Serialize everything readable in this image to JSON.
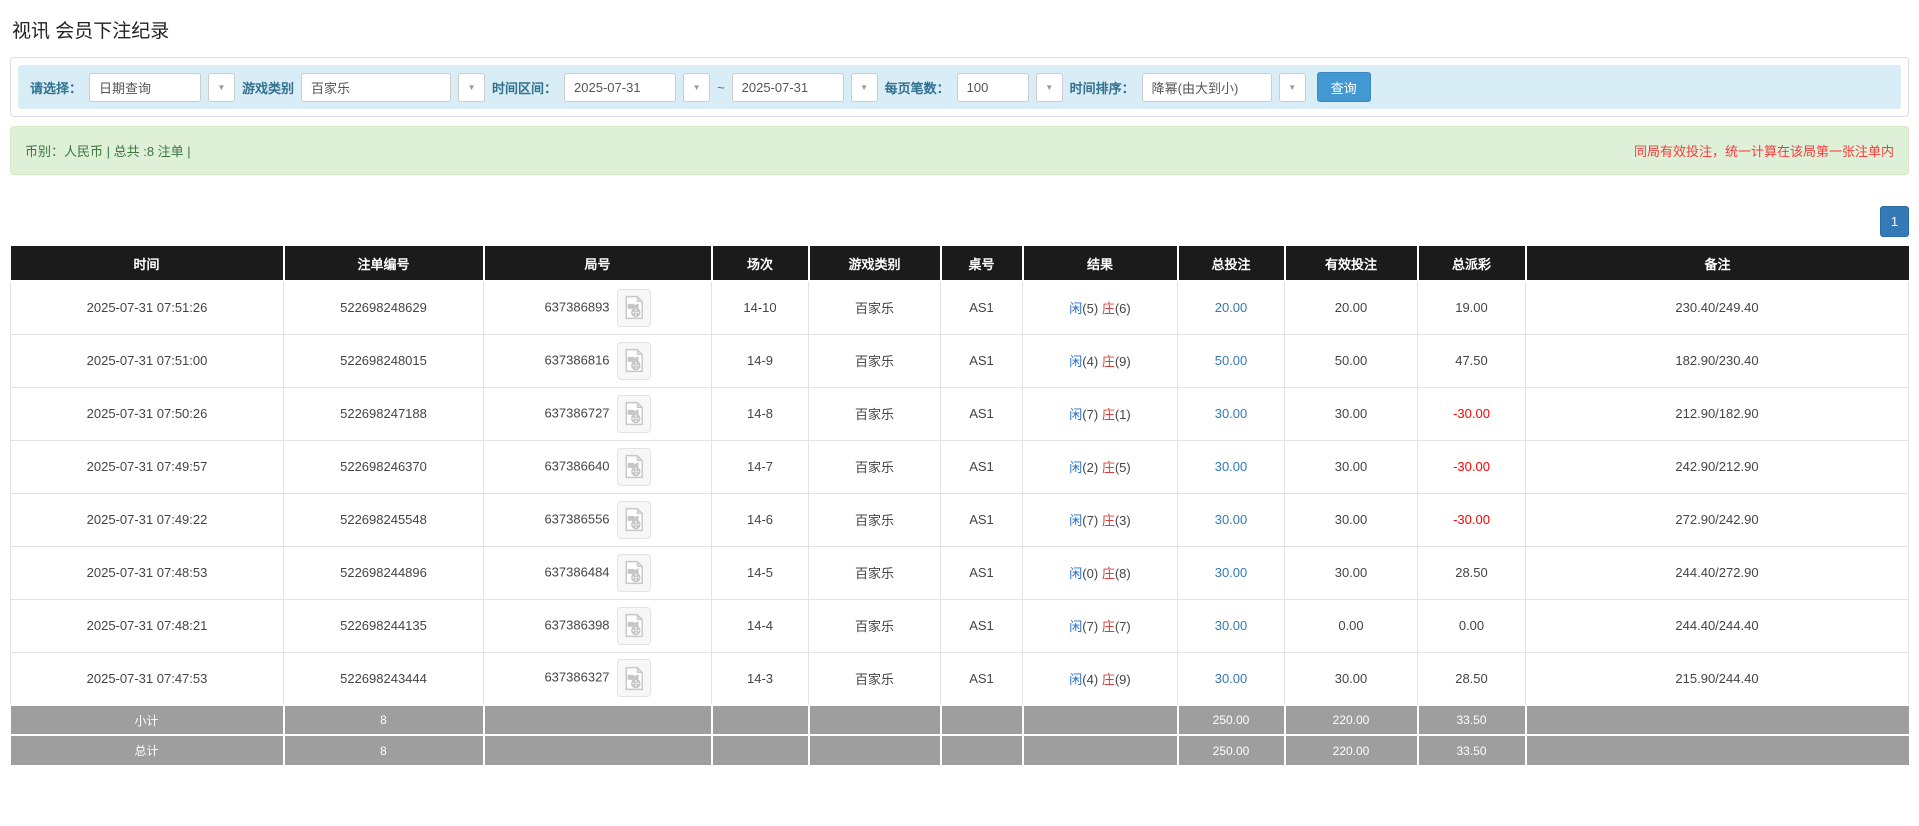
{
  "page": {
    "title": "视讯 会员下注纪录"
  },
  "icons": {
    "caret_down": "▼",
    "video_icon_name": "video-file-icon"
  },
  "filters": {
    "select_label": "请选择：",
    "select_value": "日期查询",
    "game_label": "游戏类别",
    "game_value": "百家乐",
    "range_label": "时间区间：",
    "date_from": "2025-07-31",
    "range_sep": "~",
    "date_to": "2025-07-31",
    "page_size_label": "每页笔数：",
    "page_size_value": "100",
    "sort_label": "时间排序：",
    "sort_value": "降幂(由大到小)",
    "search_button": "查询"
  },
  "summary": {
    "left": "币别：人民币 | 总共 :8 注单 |",
    "note": "同局有效投注，统一计算在该局第一张注单内"
  },
  "pagination": {
    "current": "1"
  },
  "table": {
    "headers": [
      "时间",
      "注单编号",
      "局号",
      "场次",
      "游戏类别",
      "桌号",
      "结果",
      "总投注",
      "有效投注",
      "总派彩",
      "备注"
    ],
    "rows": [
      {
        "time": "2025-07-31 07:51:26",
        "bet_no": "522698248629",
        "round_no": "637386893",
        "session": "14-10",
        "game": "百家乐",
        "table_no": "AS1",
        "player_label": "闲",
        "player_score": "(5)",
        "banker_label": "庄",
        "banker_score": "(6)",
        "total_bet": "20.00",
        "valid_bet": "20.00",
        "payout": "19.00",
        "note": "230.40/249.40"
      },
      {
        "time": "2025-07-31 07:51:00",
        "bet_no": "522698248015",
        "round_no": "637386816",
        "session": "14-9",
        "game": "百家乐",
        "table_no": "AS1",
        "player_label": "闲",
        "player_score": "(4)",
        "banker_label": "庄",
        "banker_score": "(9)",
        "total_bet": "50.00",
        "valid_bet": "50.00",
        "payout": "47.50",
        "note": "182.90/230.40"
      },
      {
        "time": "2025-07-31 07:50:26",
        "bet_no": "522698247188",
        "round_no": "637386727",
        "session": "14-8",
        "game": "百家乐",
        "table_no": "AS1",
        "player_label": "闲",
        "player_score": "(7)",
        "banker_label": "庄",
        "banker_score": "(1)",
        "total_bet": "30.00",
        "valid_bet": "30.00",
        "payout": "-30.00",
        "note": "212.90/182.90"
      },
      {
        "time": "2025-07-31 07:49:57",
        "bet_no": "522698246370",
        "round_no": "637386640",
        "session": "14-7",
        "game": "百家乐",
        "table_no": "AS1",
        "player_label": "闲",
        "player_score": "(2)",
        "banker_label": "庄",
        "banker_score": "(5)",
        "total_bet": "30.00",
        "valid_bet": "30.00",
        "payout": "-30.00",
        "note": "242.90/212.90"
      },
      {
        "time": "2025-07-31 07:49:22",
        "bet_no": "522698245548",
        "round_no": "637386556",
        "session": "14-6",
        "game": "百家乐",
        "table_no": "AS1",
        "player_label": "闲",
        "player_score": "(7)",
        "banker_label": "庄",
        "banker_score": "(3)",
        "total_bet": "30.00",
        "valid_bet": "30.00",
        "payout": "-30.00",
        "note": "272.90/242.90"
      },
      {
        "time": "2025-07-31 07:48:53",
        "bet_no": "522698244896",
        "round_no": "637386484",
        "session": "14-5",
        "game": "百家乐",
        "table_no": "AS1",
        "player_label": "闲",
        "player_score": "(0)",
        "banker_label": "庄",
        "banker_score": "(8)",
        "total_bet": "30.00",
        "valid_bet": "30.00",
        "payout": "28.50",
        "note": "244.40/272.90"
      },
      {
        "time": "2025-07-31 07:48:21",
        "bet_no": "522698244135",
        "round_no": "637386398",
        "session": "14-4",
        "game": "百家乐",
        "table_no": "AS1",
        "player_label": "闲",
        "player_score": "(7)",
        "banker_label": "庄",
        "banker_score": "(7)",
        "total_bet": "30.00",
        "valid_bet": "0.00",
        "payout": "0.00",
        "note": "244.40/244.40"
      },
      {
        "time": "2025-07-31 07:47:53",
        "bet_no": "522698243444",
        "round_no": "637386327",
        "session": "14-3",
        "game": "百家乐",
        "table_no": "AS1",
        "player_label": "闲",
        "player_score": "(4)",
        "banker_label": "庄",
        "banker_score": "(9)",
        "total_bet": "30.00",
        "valid_bet": "30.00",
        "payout": "28.50",
        "note": "215.90/244.40"
      }
    ],
    "footer": [
      {
        "label": "小计",
        "count": "8",
        "total_bet": "250.00",
        "valid_bet": "220.00",
        "payout": "33.50"
      },
      {
        "label": "总计",
        "count": "8",
        "total_bet": "250.00",
        "valid_bet": "220.00",
        "payout": "33.50"
      }
    ]
  }
}
